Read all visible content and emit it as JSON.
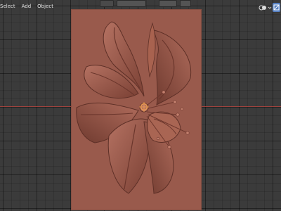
{
  "header": {
    "menu": [
      {
        "id": "select",
        "label": "Select"
      },
      {
        "id": "add",
        "label": "Add"
      },
      {
        "id": "object",
        "label": "Object"
      }
    ]
  },
  "icons": {
    "overlays": "overlays-icon",
    "gizmo": "gizmo-icon",
    "origin": "object-origin-icon"
  },
  "colors": {
    "grid_background": "#3b3b3b",
    "x_axis": "#b0443e",
    "relief": "#995a4c",
    "active_button": "#5680c2"
  }
}
